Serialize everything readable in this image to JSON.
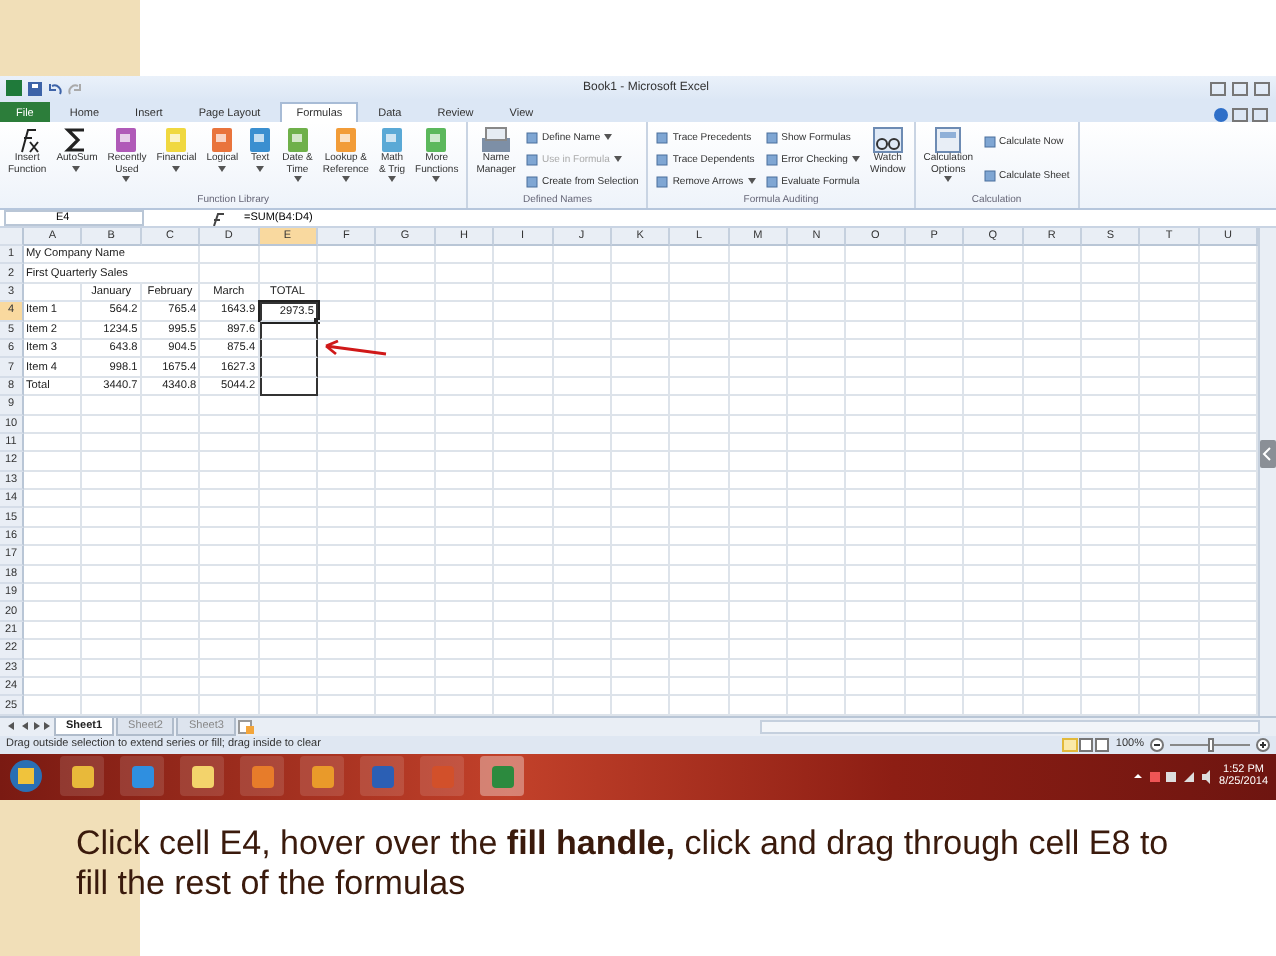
{
  "window": {
    "title": "Book1 - Microsoft Excel"
  },
  "tabs": [
    {
      "label": "File",
      "kind": "file",
      "selected": false
    },
    {
      "label": "Home",
      "kind": "tab",
      "selected": false
    },
    {
      "label": "Insert",
      "kind": "tab",
      "selected": false
    },
    {
      "label": "Page Layout",
      "kind": "tab",
      "selected": false
    },
    {
      "label": "Formulas",
      "kind": "tab",
      "selected": true
    },
    {
      "label": "Data",
      "kind": "tab",
      "selected": false
    },
    {
      "label": "Review",
      "kind": "tab",
      "selected": false
    },
    {
      "label": "View",
      "kind": "tab",
      "selected": false
    }
  ],
  "ribbon": [
    {
      "label": "Function Library",
      "items": [
        {
          "kind": "fx",
          "lines": [
            "Insert",
            "Function"
          ],
          "dropdown": false
        },
        {
          "kind": "sigma",
          "lines": [
            "AutoSum"
          ],
          "dropdown": true
        },
        {
          "kind": "book",
          "lines": [
            "Recently",
            "Used"
          ],
          "dropdown": true
        },
        {
          "kind": "book",
          "lines": [
            "Financial"
          ],
          "dropdown": true
        },
        {
          "kind": "book",
          "lines": [
            "Logical"
          ],
          "dropdown": true
        },
        {
          "kind": "book",
          "lines": [
            "Text"
          ],
          "dropdown": true
        },
        {
          "kind": "book",
          "lines": [
            "Date &",
            "Time"
          ],
          "dropdown": true
        },
        {
          "kind": "book",
          "lines": [
            "Lookup &",
            "Reference"
          ],
          "dropdown": true
        },
        {
          "kind": "book",
          "lines": [
            "Math",
            "& Trig"
          ],
          "dropdown": true
        },
        {
          "kind": "book",
          "lines": [
            "More",
            "Functions"
          ],
          "dropdown": true
        }
      ]
    },
    {
      "label": "Defined Names",
      "items": [
        {
          "kind": "manager",
          "lines": [
            "Name",
            "Manager"
          ],
          "dropdown": false
        },
        {
          "kind": "small",
          "label": "Define Name",
          "dropdown": true,
          "disabled": false
        },
        {
          "kind": "small",
          "label": "Use in Formula",
          "dropdown": true,
          "disabled": true
        },
        {
          "kind": "small",
          "label": "Create from Selection",
          "dropdown": false,
          "disabled": false
        }
      ]
    },
    {
      "label": "Formula Auditing",
      "items": [
        {
          "kind": "small",
          "label": "Trace Precedents",
          "dropdown": false,
          "disabled": false
        },
        {
          "kind": "small",
          "label": "Trace Dependents",
          "dropdown": false,
          "disabled": false
        },
        {
          "kind": "small",
          "label": "Remove Arrows",
          "dropdown": true,
          "disabled": false
        },
        {
          "kind": "small",
          "label": "Show Formulas",
          "dropdown": false,
          "disabled": false
        },
        {
          "kind": "small",
          "label": "Error Checking",
          "dropdown": true,
          "disabled": false
        },
        {
          "kind": "small",
          "label": "Evaluate Formula",
          "dropdown": false,
          "disabled": false
        },
        {
          "kind": "watch",
          "lines": [
            "Watch",
            "Window"
          ],
          "dropdown": false
        }
      ]
    },
    {
      "label": "Calculation",
      "items": [
        {
          "kind": "calc",
          "lines": [
            "Calculation",
            "Options"
          ],
          "dropdown": true
        },
        {
          "kind": "small",
          "label": "Calculate Now",
          "dropdown": false,
          "disabled": false
        },
        {
          "kind": "small",
          "label": "Calculate Sheet",
          "dropdown": false,
          "disabled": false
        }
      ]
    }
  ],
  "formula_bar": {
    "name_box": "E4",
    "formula": "=SUM(B4:D4)"
  },
  "columns": [
    {
      "label": "A",
      "selected": false
    },
    {
      "label": "B",
      "selected": false
    },
    {
      "label": "C",
      "selected": false
    },
    {
      "label": "D",
      "selected": false
    },
    {
      "label": "E",
      "selected": true
    },
    {
      "label": "F",
      "selected": false
    },
    {
      "label": "G",
      "selected": false
    },
    {
      "label": "H",
      "selected": false
    },
    {
      "label": "I",
      "selected": false
    },
    {
      "label": "J",
      "selected": false
    },
    {
      "label": "K",
      "selected": false
    },
    {
      "label": "L",
      "selected": false
    },
    {
      "label": "M",
      "selected": false
    },
    {
      "label": "N",
      "selected": false
    },
    {
      "label": "O",
      "selected": false
    },
    {
      "label": "P",
      "selected": false
    },
    {
      "label": "Q",
      "selected": false
    },
    {
      "label": "R",
      "selected": false
    },
    {
      "label": "S",
      "selected": false
    },
    {
      "label": "T",
      "selected": false
    },
    {
      "label": "U",
      "selected": false
    }
  ],
  "rows": [
    {
      "number": "1",
      "label": "My Company Name",
      "selected": false,
      "in_range": false
    },
    {
      "number": "2",
      "label": "First Quarterly Sales",
      "selected": false,
      "in_range": false
    },
    {
      "number": "3",
      "kind": "header",
      "values": [
        "January",
        "February",
        "March",
        "TOTAL"
      ],
      "selected": false,
      "in_range": false
    },
    {
      "number": "4",
      "kind": "data",
      "label": "Item 1",
      "values": [
        "564.2",
        "765.4",
        "1643.9",
        "2973.5"
      ],
      "selected": true,
      "in_range": true
    },
    {
      "number": "5",
      "kind": "data",
      "label": "Item 2",
      "values": [
        "1234.5",
        "995.5",
        "897.6"
      ],
      "selected": false,
      "in_range": true
    },
    {
      "number": "6",
      "kind": "data",
      "label": "Item 3",
      "values": [
        "643.8",
        "904.5",
        "875.4"
      ],
      "selected": false,
      "in_range": true
    },
    {
      "number": "7",
      "kind": "data",
      "label": "Item 4",
      "values": [
        "998.1",
        "1675.4",
        "1627.3"
      ],
      "selected": false,
      "in_range": true
    },
    {
      "number": "8",
      "kind": "data",
      "label": "Total",
      "values": [
        "3440.7",
        "4340.8",
        "5044.2"
      ],
      "selected": false,
      "in_range": true
    },
    {
      "number": "9",
      "selected": false,
      "in_range": false
    },
    {
      "number": "10",
      "selected": false,
      "in_range": false
    },
    {
      "number": "11",
      "selected": false,
      "in_range": false
    },
    {
      "number": "12",
      "selected": false,
      "in_range": false
    },
    {
      "number": "13",
      "selected": false,
      "in_range": false
    },
    {
      "number": "14",
      "selected": false,
      "in_range": false
    },
    {
      "number": "15",
      "selected": false,
      "in_range": false
    },
    {
      "number": "16",
      "selected": false,
      "in_range": false
    },
    {
      "number": "17",
      "selected": false,
      "in_range": false
    },
    {
      "number": "18",
      "selected": false,
      "in_range": false
    },
    {
      "number": "19",
      "selected": false,
      "in_range": false
    },
    {
      "number": "20",
      "selected": false,
      "in_range": false
    },
    {
      "number": "21",
      "selected": false,
      "in_range": false
    },
    {
      "number": "22",
      "selected": false,
      "in_range": false
    },
    {
      "number": "23",
      "selected": false,
      "in_range": false
    },
    {
      "number": "24",
      "selected": false,
      "in_range": false
    },
    {
      "number": "25",
      "selected": false,
      "in_range": false
    }
  ],
  "sheets": [
    {
      "label": "Sheet1",
      "selected": true
    },
    {
      "label": "Sheet2",
      "selected": false
    },
    {
      "label": "Sheet3",
      "selected": false
    }
  ],
  "status_bar": {
    "message": "Drag outside selection to extend series or fill; drag inside to clear",
    "zoom": "100%",
    "zoom_slider": {
      "level": 0.5
    }
  },
  "taskbar": {
    "time": "1:52 PM",
    "date": "8/25/2014"
  },
  "caption": "Click cell E4, hover over the **fill handle,** click and drag through cell E8 to fill the rest of the formulas"
}
